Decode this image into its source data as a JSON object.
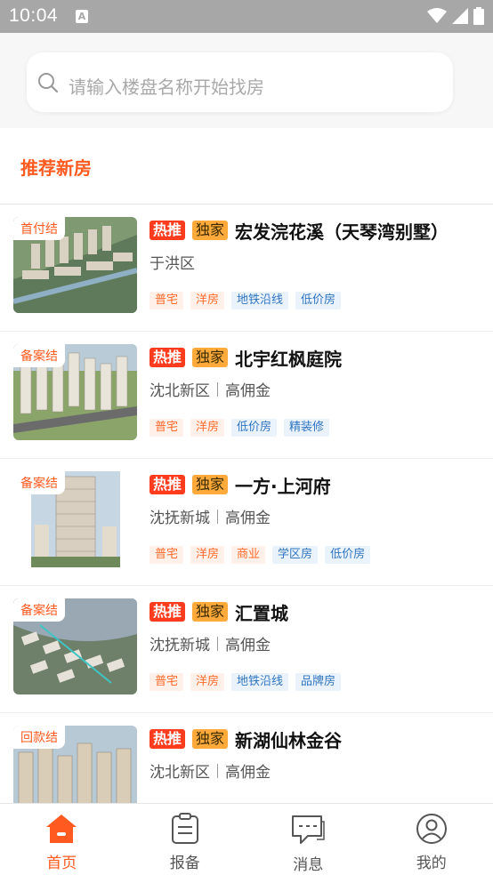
{
  "status_bar": {
    "time": "10:04",
    "notification": "A"
  },
  "search": {
    "placeholder": "请输入楼盘名称开始找房"
  },
  "section": {
    "title": "推荐新房"
  },
  "listings": [
    {
      "badge": "首付结",
      "hot": "热推",
      "exclusive": "独家",
      "name": "宏发浣花溪（天琴湾别墅）",
      "district": "于洪区",
      "commission": "",
      "tags": [
        {
          "text": "普宅",
          "color": "orange"
        },
        {
          "text": "洋房",
          "color": "orange"
        },
        {
          "text": "地铁沿线",
          "color": "blue"
        },
        {
          "text": "低价房",
          "color": "blue"
        }
      ]
    },
    {
      "badge": "备案结",
      "hot": "热推",
      "exclusive": "独家",
      "name": "北宇红枫庭院",
      "district": "沈北新区",
      "commission": "高佣金",
      "tags": [
        {
          "text": "普宅",
          "color": "orange"
        },
        {
          "text": "洋房",
          "color": "orange"
        },
        {
          "text": "低价房",
          "color": "blue"
        },
        {
          "text": "精装修",
          "color": "blue"
        }
      ]
    },
    {
      "badge": "备案结",
      "hot": "热推",
      "exclusive": "独家",
      "name": "一方·上河府",
      "district": "沈抚新城",
      "commission": "高佣金",
      "tags": [
        {
          "text": "普宅",
          "color": "orange"
        },
        {
          "text": "洋房",
          "color": "orange"
        },
        {
          "text": "商业",
          "color": "orange"
        },
        {
          "text": "学区房",
          "color": "blue"
        },
        {
          "text": "低价房",
          "color": "blue"
        }
      ]
    },
    {
      "badge": "备案结",
      "hot": "热推",
      "exclusive": "独家",
      "name": "汇置城",
      "district": "沈抚新城",
      "commission": "高佣金",
      "tags": [
        {
          "text": "普宅",
          "color": "orange"
        },
        {
          "text": "洋房",
          "color": "orange"
        },
        {
          "text": "地铁沿线",
          "color": "blue"
        },
        {
          "text": "品牌房",
          "color": "blue"
        }
      ]
    },
    {
      "badge": "回款结",
      "hot": "热推",
      "exclusive": "独家",
      "name": "新湖仙林金谷",
      "district": "沈北新区",
      "commission": "高佣金",
      "tags": []
    }
  ],
  "nav": [
    {
      "label": "首页",
      "icon": "home-icon",
      "active": true
    },
    {
      "label": "报备",
      "icon": "clipboard-icon",
      "active": false
    },
    {
      "label": "消息",
      "icon": "message-icon",
      "active": false
    },
    {
      "label": "我的",
      "icon": "user-icon",
      "active": false
    }
  ],
  "colors": {
    "accent": "#ff5a1f",
    "hot": "#ff3d1e",
    "exclusive": "#ffaa3a"
  }
}
